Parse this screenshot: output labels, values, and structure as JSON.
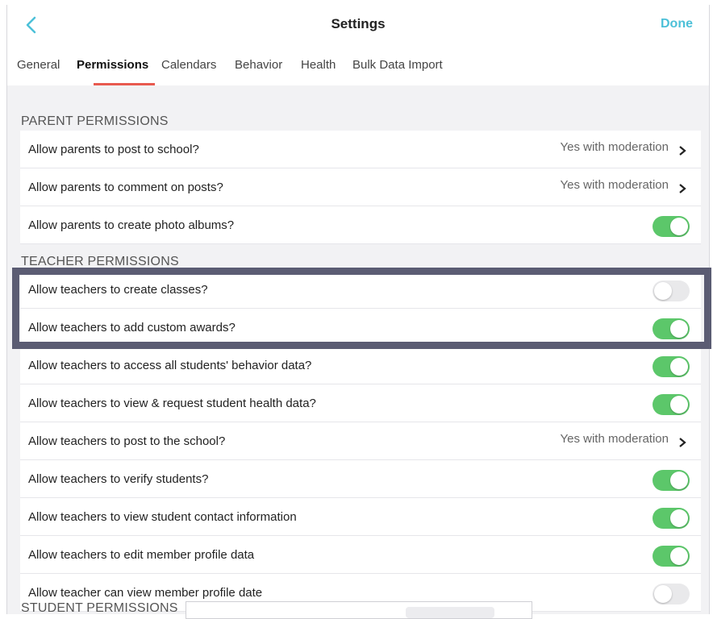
{
  "header": {
    "title": "Settings",
    "done_label": "Done",
    "back_icon": "chevron-left-icon",
    "accent": "#4cc0d8"
  },
  "tabs": [
    {
      "label": "General"
    },
    {
      "label": "Permissions",
      "active": true
    },
    {
      "label": "Calendars"
    },
    {
      "label": "Behavior"
    },
    {
      "label": "Health"
    },
    {
      "label": "Bulk Data Import"
    }
  ],
  "sections": {
    "parent": {
      "title": "PARENT PERMISSIONS",
      "rows": [
        {
          "label": "Allow parents to post to school?",
          "value": "Yes with moderation"
        },
        {
          "label": "Allow parents to comment on posts?",
          "value": "Yes with moderation"
        },
        {
          "label": "Allow parents to create photo albums?",
          "toggle": "on"
        }
      ]
    },
    "teacher": {
      "title": "TEACHER PERMISSIONS",
      "rows": [
        {
          "label": "Allow teachers to create classes?",
          "toggle": "off"
        },
        {
          "label": "Allow teachers to add custom awards?",
          "toggle": "on"
        },
        {
          "label": "Allow teachers to access all students' behavior data?",
          "toggle": "on"
        },
        {
          "label": "Allow teachers to view & request student health data?",
          "toggle": "on"
        },
        {
          "label": "Allow teachers to post to the school?",
          "value": "Yes with moderation"
        },
        {
          "label": "Allow teachers to verify students?",
          "toggle": "on"
        },
        {
          "label": "Allow teachers to view student contact information",
          "toggle": "on"
        },
        {
          "label": "Allow teachers to edit member profile data",
          "toggle": "on"
        },
        {
          "label": "Allow teacher can view member profile date",
          "toggle": "off"
        }
      ]
    },
    "student": {
      "title": "STUDENT PERMISSIONS"
    }
  },
  "colors": {
    "toggle_on": "#5cc76a",
    "tab_underline": "#e85a4f",
    "highlight_border": "#5b5c73"
  }
}
